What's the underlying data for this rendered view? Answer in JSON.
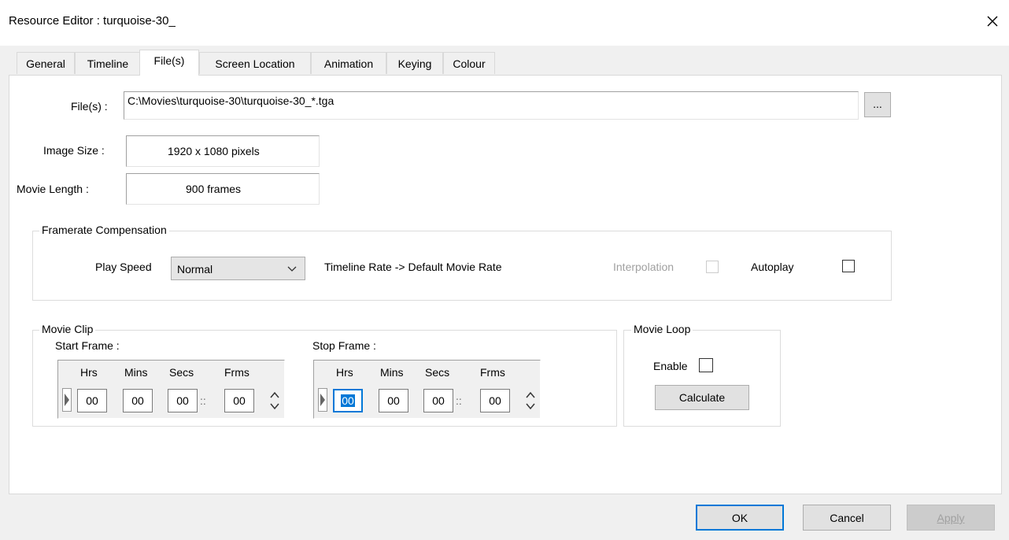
{
  "window": {
    "title": "Resource Editor  :  turquoise-30_",
    "close_icon": "close-icon"
  },
  "tabs": [
    {
      "label": "General"
    },
    {
      "label": "Timeline"
    },
    {
      "label": "File(s)",
      "active": true
    },
    {
      "label": "Screen Location"
    },
    {
      "label": "Animation"
    },
    {
      "label": "Keying"
    },
    {
      "label": "Colour"
    }
  ],
  "files": {
    "files_label": "File(s) :",
    "files_value": "C:\\Movies\\turquoise-30\\turquoise-30_*.tga",
    "browse_label": "...",
    "image_size_label": "Image Size :",
    "image_size_value": "1920 x 1080 pixels",
    "movie_length_label": "Movie Length :",
    "movie_length_value": "900  frames"
  },
  "framerate": {
    "group_title": "Framerate Compensation",
    "play_speed_label": "Play Speed",
    "play_speed_value": "Normal",
    "timeline_rate_text": "Timeline Rate -> Default Movie Rate",
    "interpolation_label": "Interpolation",
    "autoplay_label": "Autoplay"
  },
  "movie_clip": {
    "group_title": "Movie Clip",
    "start_frame_label": "Start Frame :",
    "stop_frame_label": "Stop Frame :",
    "headers": [
      "Hrs",
      "Mins",
      "Secs",
      "Frms"
    ],
    "start": {
      "hrs": "00",
      "mins": "00",
      "secs": "00",
      "frms": "00"
    },
    "stop": {
      "hrs": "00",
      "mins": "00",
      "secs": "00",
      "frms": "00"
    },
    "sep1": ":",
    "sep2": "::"
  },
  "movie_loop": {
    "group_title": "Movie Loop",
    "enable_label": "Enable",
    "calculate_label": "Calculate"
  },
  "footer": {
    "ok_label": "OK",
    "cancel_label": "Cancel",
    "apply_label": "Apply"
  },
  "colors": {
    "selection": "#0078d7",
    "ok_border": "#0078d7",
    "disabled_text": "#a0a0a0"
  }
}
